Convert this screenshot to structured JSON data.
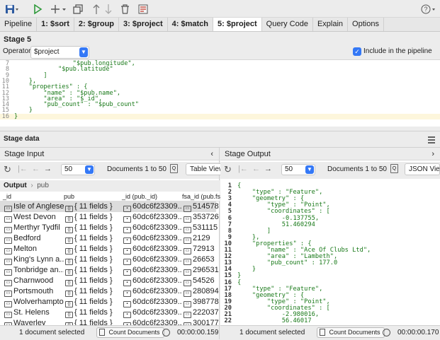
{
  "toolbar": {
    "icons": [
      "save-icon",
      "run-icon",
      "add-stage-icon",
      "duplicate-icon",
      "move-up-icon",
      "move-down-icon",
      "delete-icon",
      "preview-icon",
      "help-icon"
    ]
  },
  "tabs": [
    {
      "label": "Pipeline",
      "stage": false,
      "active": false
    },
    {
      "label": "1: $sort",
      "stage": true,
      "active": false
    },
    {
      "label": "2: $group",
      "stage": true,
      "active": false
    },
    {
      "label": "3: $project",
      "stage": true,
      "active": false
    },
    {
      "label": "4: $match",
      "stage": true,
      "active": false
    },
    {
      "label": "5: $project",
      "stage": true,
      "active": true
    },
    {
      "label": "Query Code",
      "stage": false,
      "active": false
    },
    {
      "label": "Explain",
      "stage": false,
      "active": false
    },
    {
      "label": "Options",
      "stage": false,
      "active": false
    }
  ],
  "stage": {
    "title": "Stage 5",
    "operator_label": "Operator:",
    "operator_value": "$project",
    "include_label": "Include in the pipeline",
    "include_checked": true
  },
  "code_lines": [
    {
      "n": "7",
      "t": "                \"$pub.longitude\","
    },
    {
      "n": "8",
      "t": "            \"$pub.latitude\""
    },
    {
      "n": "9",
      "t": "        ]"
    },
    {
      "n": "10",
      "t": "    },"
    },
    {
      "n": "11",
      "t": "    \"properties\" : {"
    },
    {
      "n": "12",
      "t": "        \"name\" : \"$pub.name\","
    },
    {
      "n": "13",
      "t": "        \"area\" : \"$_id\","
    },
    {
      "n": "14",
      "t": "        \"pub_count\" : \"$pub_count\""
    },
    {
      "n": "15",
      "t": "    }"
    },
    {
      "n": "16",
      "t": "}"
    }
  ],
  "stage_data": {
    "title": "Stage data"
  },
  "input": {
    "header": "Stage Input",
    "page_size": "50",
    "documents_label": "Documents 1 to 50",
    "view_label": "Table View",
    "breadcrumb_root": "Output",
    "breadcrumb_child": "pub",
    "columns": [
      "_id",
      "pub",
      "_id (pub._id)",
      "fsa_id (pub.fsa"
    ],
    "rows": [
      {
        "id": "Isle of Anglesey",
        "pub": "{ 11 fields }",
        "oid": "60dc6f23309...",
        "fsa": "514578"
      },
      {
        "id": "West Devon",
        "pub": "{ 11 fields }",
        "oid": "60dc6f23309...",
        "fsa": "353726"
      },
      {
        "id": "Merthyr Tydfil",
        "pub": "{ 11 fields }",
        "oid": "60dc6f23309...",
        "fsa": "531115"
      },
      {
        "id": "Bedford",
        "pub": "{ 11 fields }",
        "oid": "60dc6f23309...",
        "fsa": "2129"
      },
      {
        "id": "Melton",
        "pub": "{ 11 fields }",
        "oid": "60dc6f23309...",
        "fsa": "72913"
      },
      {
        "id": "King's Lynn a...",
        "pub": "{ 11 fields }",
        "oid": "60dc6f23309...",
        "fsa": "26653"
      },
      {
        "id": "Tonbridge an...",
        "pub": "{ 11 fields }",
        "oid": "60dc6f23309...",
        "fsa": "296531"
      },
      {
        "id": "Charnwood",
        "pub": "{ 11 fields }",
        "oid": "60dc6f23309...",
        "fsa": "54526"
      },
      {
        "id": "Portsmouth",
        "pub": "{ 11 fields }",
        "oid": "60dc6f23309...",
        "fsa": "280894"
      },
      {
        "id": "Wolverhampton",
        "pub": "{ 11 fields }",
        "oid": "60dc6f23309...",
        "fsa": "398778"
      },
      {
        "id": "St. Helens",
        "pub": "{ 11 fields }",
        "oid": "60dc6f23309...",
        "fsa": "222037"
      },
      {
        "id": "Waverley",
        "pub": "{ 11 fields }",
        "oid": "60dc6f23309...",
        "fsa": "300177"
      }
    ],
    "status": "1 document selected",
    "count_label": "Count Documents",
    "time": "00:00:00.159"
  },
  "output": {
    "header": "Stage Output",
    "page_size": "50",
    "documents_label": "Documents 1 to 50",
    "view_label": "JSON View",
    "json_lines": [
      {
        "n": "1",
        "t": "{"
      },
      {
        "n": "2",
        "t": "    \"type\" : \"Feature\","
      },
      {
        "n": "3",
        "t": "    \"geometry\" : {"
      },
      {
        "n": "4",
        "t": "        \"type\" : \"Point\","
      },
      {
        "n": "5",
        "t": "        \"coordinates\" : ["
      },
      {
        "n": "6",
        "t": "            -0.137755,"
      },
      {
        "n": "7",
        "t": "            51.460294"
      },
      {
        "n": "8",
        "t": "        ]"
      },
      {
        "n": "9",
        "t": "    },"
      },
      {
        "n": "10",
        "t": "    \"properties\" : {"
      },
      {
        "n": "11",
        "t": "        \"name\" : \"Ace Of Clubs Ltd\","
      },
      {
        "n": "12",
        "t": "        \"area\" : \"Lambeth\","
      },
      {
        "n": "13",
        "t": "        \"pub_count\" : 177.0"
      },
      {
        "n": "14",
        "t": "    }"
      },
      {
        "n": "15",
        "t": "}"
      },
      {
        "n": "16",
        "t": "{"
      },
      {
        "n": "17",
        "t": "    \"type\" : \"Feature\","
      },
      {
        "n": "18",
        "t": "    \"geometry\" : {"
      },
      {
        "n": "19",
        "t": "        \"type\" : \"Point\","
      },
      {
        "n": "20",
        "t": "        \"coordinates\" : ["
      },
      {
        "n": "21",
        "t": "            -2.980016,"
      },
      {
        "n": "22",
        "t": "            56.46017"
      }
    ],
    "status": "1 document selected",
    "count_label": "Count Documents",
    "time": "00:00:00.170"
  },
  "colors": {
    "accent": "#3478f6",
    "selected_row": "#dcdcdc",
    "highlight_line": "#fdf6dc"
  }
}
